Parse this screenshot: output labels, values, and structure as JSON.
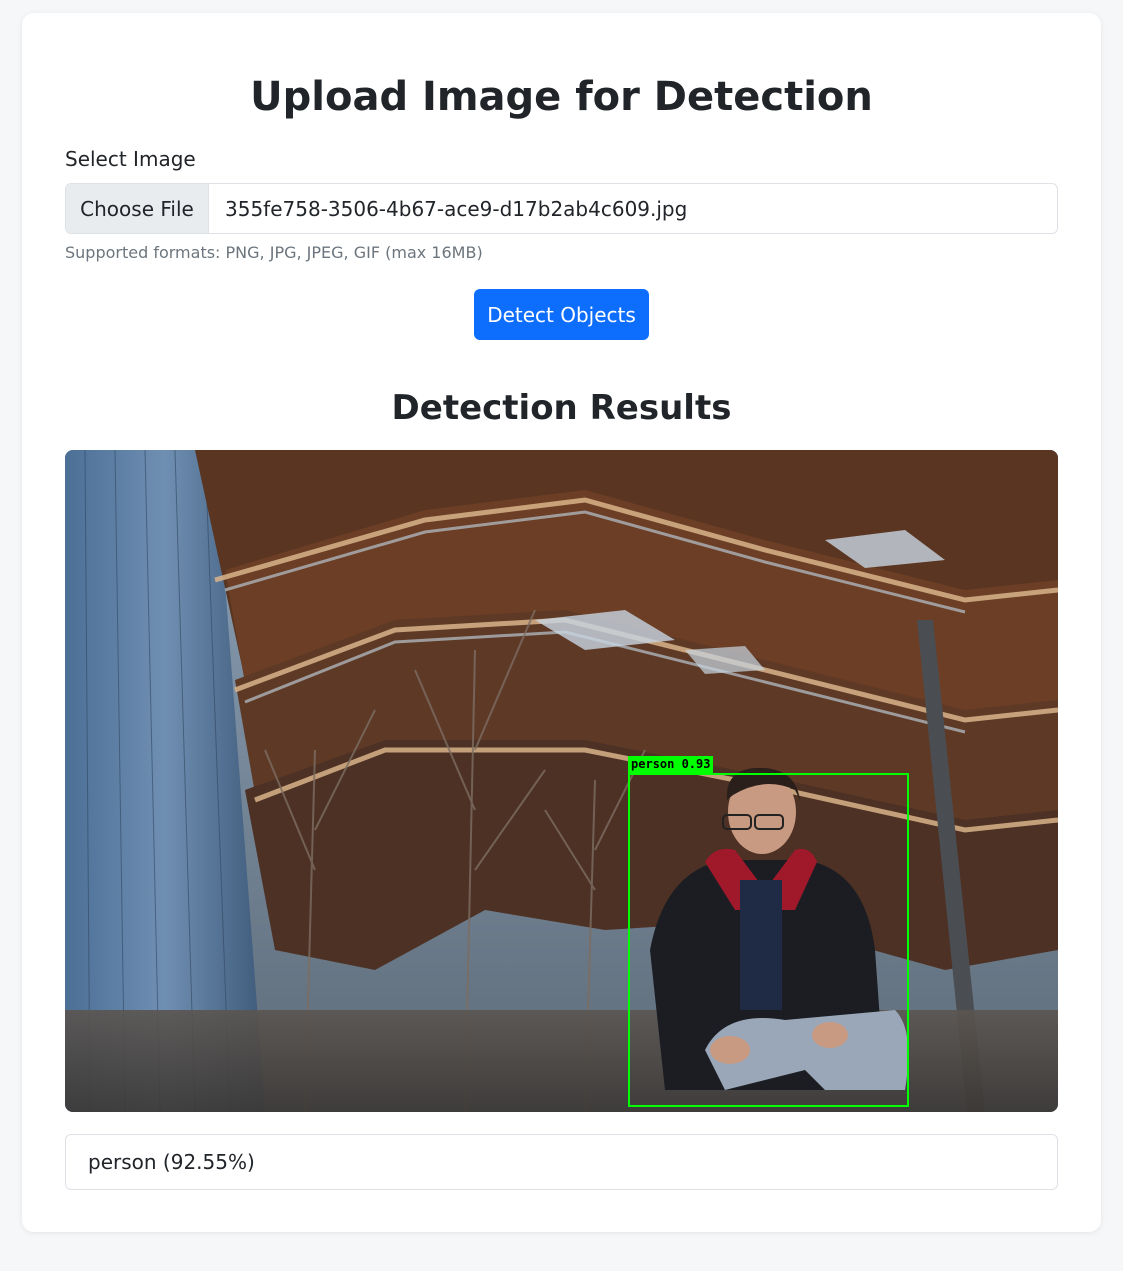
{
  "page": {
    "title": "Upload Image for Detection"
  },
  "form": {
    "select_label": "Select Image",
    "choose_file_label": "Choose File",
    "file_name": "355fe758-3506-4b67-ace9-d17b2ab4c609.jpg",
    "help_text": "Supported formats: PNG, JPG, JPEG, GIF (max 16MB)",
    "detect_button": "Detect Objects"
  },
  "results": {
    "title": "Detection Results",
    "image_overlay_label": "person 0.93",
    "items": [
      {
        "text": "person (92.55%)"
      }
    ]
  },
  "colors": {
    "primary_button": "#0d6efd",
    "bbox": "#00ff00"
  }
}
